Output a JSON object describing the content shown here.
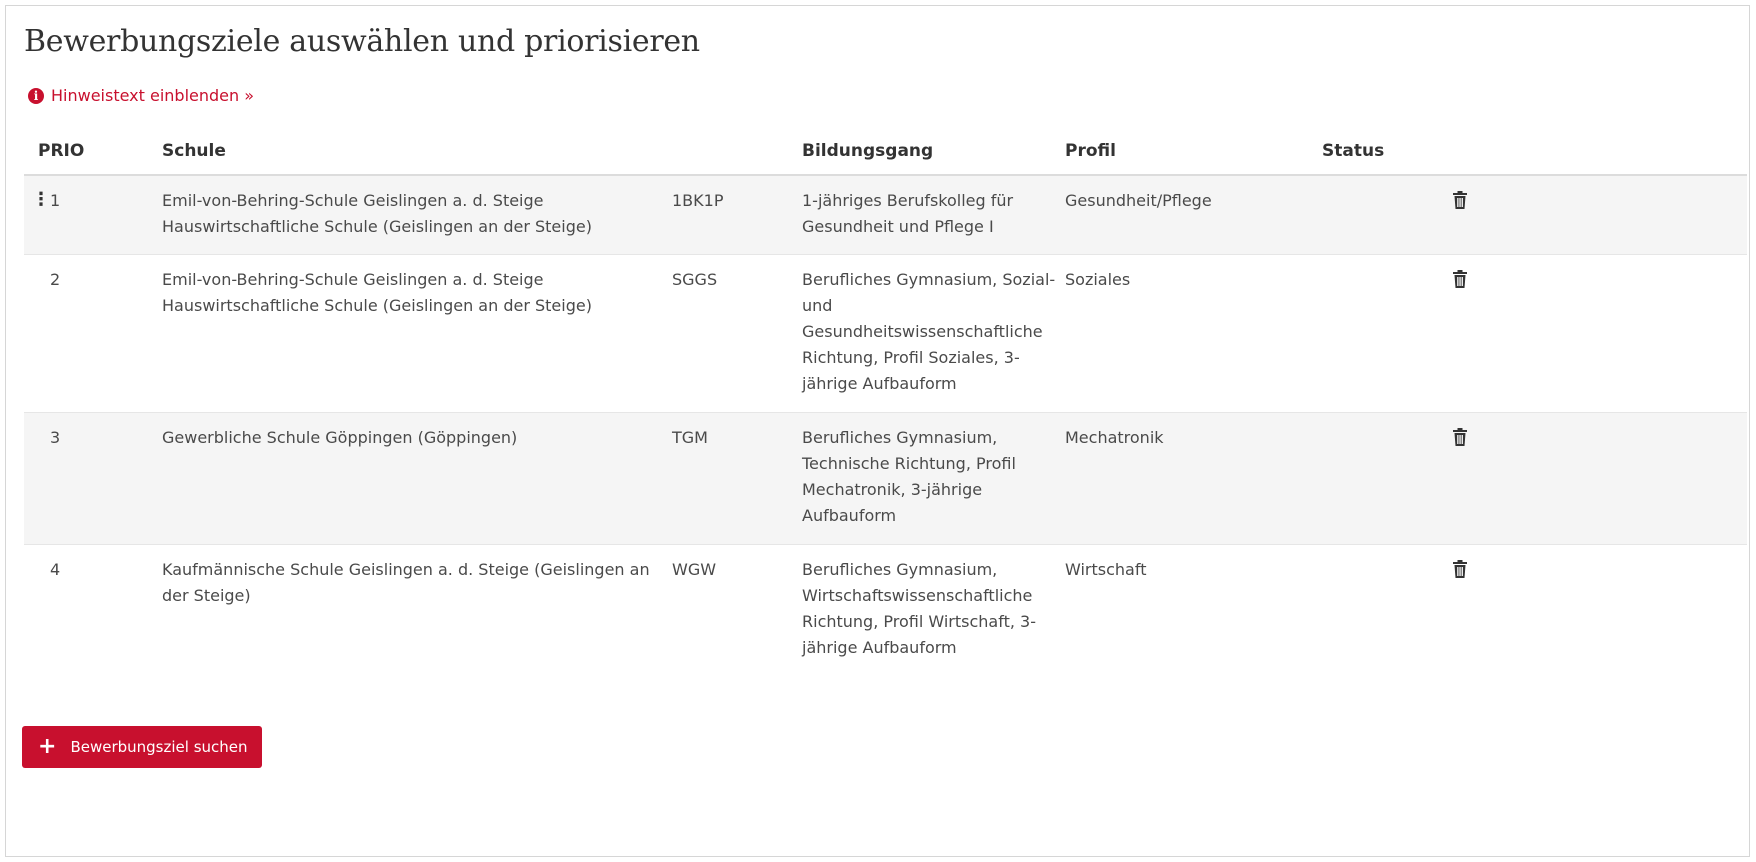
{
  "page": {
    "title": "Bewerbungsziele auswählen und priorisieren",
    "hint_link": "Hinweistext einblenden »",
    "hint_icon": "info-circle-icon"
  },
  "table": {
    "headers": {
      "prio": "PRIO",
      "schule": "Schule",
      "kuerzel": "",
      "bildungsgang": "Bildungsgang",
      "profil": "Profil",
      "status": "Status"
    },
    "rows": [
      {
        "prio": "1",
        "schule": "Emil-von-Behring-Schule Geislingen a. d. Steige Hauswirtschaftliche Schule (Geislingen an der Steige)",
        "kuerzel": "1BK1P",
        "bildungsgang": "1-jähriges Berufskolleg für Gesundheit und Pflege I",
        "profil": "Gesundheit/Pflege",
        "status": ""
      },
      {
        "prio": "2",
        "schule": "Emil-von-Behring-Schule Geislingen a. d. Steige Hauswirtschaftliche Schule (Geislingen an der Steige)",
        "kuerzel": "SGGS",
        "bildungsgang": "Berufliches Gymnasium, Sozial- und Gesundheitswissenschaftliche Richtung, Profil Soziales, 3-jährige Aufbauform",
        "profil": "Soziales",
        "status": ""
      },
      {
        "prio": "3",
        "schule": "Gewerbliche Schule Göppingen (Göppingen)",
        "kuerzel": "TGM",
        "bildungsgang": "Berufliches Gymnasium, Technische Richtung, Profil Mechatronik, 3-jährige Aufbauform",
        "profil": "Mechatronik",
        "status": ""
      },
      {
        "prio": "4",
        "schule": "Kaufmännische Schule Geislingen a. d. Steige (Geislingen an der Steige)",
        "kuerzel": "WGW",
        "bildungsgang": "Berufliches Gymnasium, Wirtschaftswissenschaftliche Richtung, Profil Wirtschaft, 3-jährige Aufbauform",
        "profil": "Wirtschaft",
        "status": ""
      }
    ]
  },
  "actions": {
    "search_button": "Bewerbungsziel suchen",
    "search_button_icon": "plus-icon",
    "delete_icon": "trash-icon",
    "drag_icon": "drag-handle-icon"
  },
  "colors": {
    "accent": "#c8102e",
    "row_stripe": "#f5f5f5",
    "text": "#333333"
  }
}
